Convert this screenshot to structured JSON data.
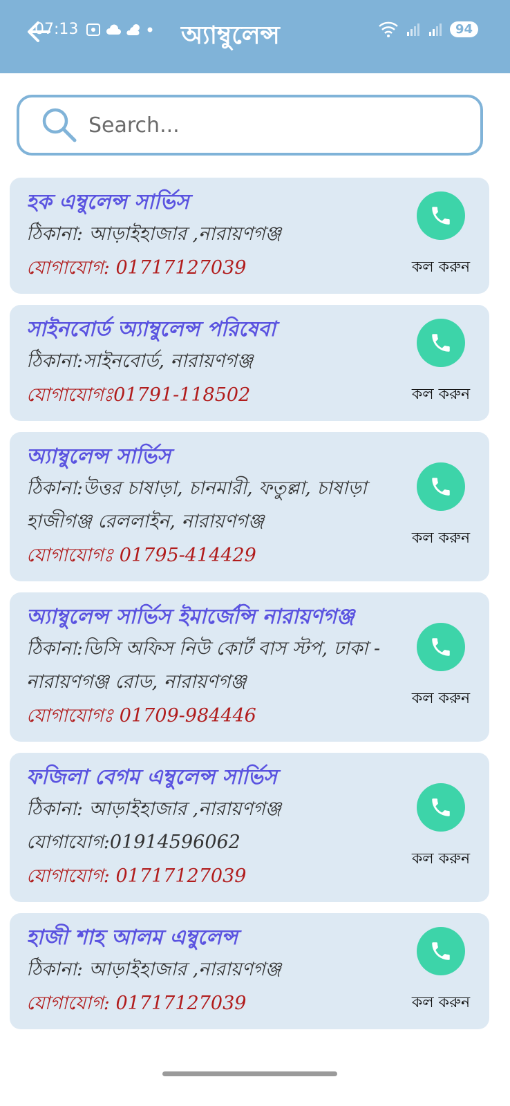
{
  "status_bar": {
    "time": "07:13",
    "battery": "94"
  },
  "header": {
    "title": "অ্যাম্বুলেন্স"
  },
  "search": {
    "placeholder": "Search..."
  },
  "call_label": "কল করুন",
  "colors": {
    "header": "#80b3d8",
    "card": "#dde9f3",
    "name": "#5a53e0",
    "contact": "#b11c1c",
    "call": "#3dd4a9"
  },
  "cards": [
    {
      "name": "হক এম্বুলেন্স সার্ভিস",
      "address": "ঠিকানা: আড়াইহাজার ,নারায়ণগঞ্জ",
      "contact": "যোগাযোগ: 01717127039",
      "call_label": "কল করুন"
    },
    {
      "name": "সাইনবোর্ড অ্যাম্বুলেন্স পরিষেবা",
      "address": "ঠিকানা:সাইনবোর্ড, নারায়ণগঞ্জ",
      "contact": "যোগাযোগঃ01791-118502",
      "call_label": "কল করুন"
    },
    {
      "name": "অ্যাম্বুলেন্স সার্ভিস",
      "address": "ঠিকানা:উত্তর চাষাড়া, চানমারী, ফতুল্লা, চাষাড়া হাজীগঞ্জ রেললাইন, নারায়ণগঞ্জ",
      "contact": "যোগাযোগঃ 01795-414429",
      "call_label": "কল করুন"
    },
    {
      "name": "অ্যাম্বুলেন্স সার্ভিস ইমার্জেন্সি নারায়ণগঞ্জ",
      "address": "ঠিকানা:ডিসি অফিস নিউ কোর্ট বাস স্টপ, ঢাকা - নারায়ণগঞ্জ রোড, নারায়ণগঞ্জ",
      "contact": "যোগাযোগঃ 01709-984446",
      "call_label": "কল করুন"
    },
    {
      "name": "ফজিলা বেগম এম্বুলেন্স সার্ভিস",
      "address": "ঠিকানা: আড়াইহাজার ,নারায়ণগঞ্জ",
      "contact_alt": "যোগাযোগ:01914596062",
      "contact": "যোগাযোগ: 01717127039",
      "call_label": "কল করুন"
    },
    {
      "name": "হাজী শাহ আলম এম্বুলেন্স",
      "address": "ঠিকানা: আড়াইহাজার ,নারায়ণগঞ্জ",
      "contact": "যোগাযোগ: 01717127039",
      "call_label": "কল করুন"
    }
  ]
}
